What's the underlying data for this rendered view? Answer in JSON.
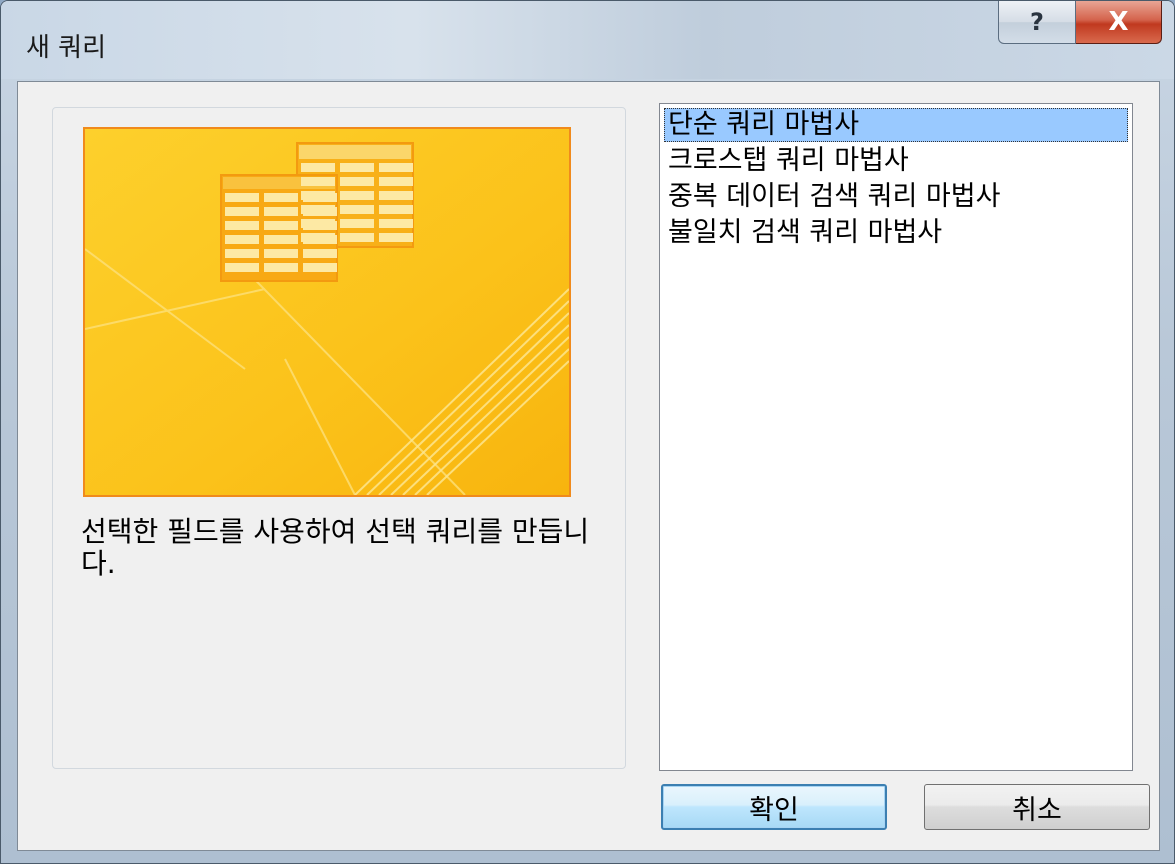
{
  "window": {
    "title": "새 쿼리",
    "help_glyph": "?",
    "close_glyph": "X"
  },
  "description": "선택한 필드를 사용하여 선택 쿼리를 만듭니다.",
  "list": {
    "items": [
      {
        "label": "단순 쿼리 마법사",
        "selected": true
      },
      {
        "label": "크로스탭 쿼리 마법사",
        "selected": false
      },
      {
        "label": "중복 데이터 검색 쿼리 마법사",
        "selected": false
      },
      {
        "label": "불일치 검색 쿼리 마법사",
        "selected": false
      }
    ]
  },
  "buttons": {
    "ok_label": "확인",
    "cancel_label": "취소"
  },
  "colors": {
    "preview_background": "#fbc31f",
    "preview_border": "#f08a1c",
    "selection": "#99c9ff"
  }
}
